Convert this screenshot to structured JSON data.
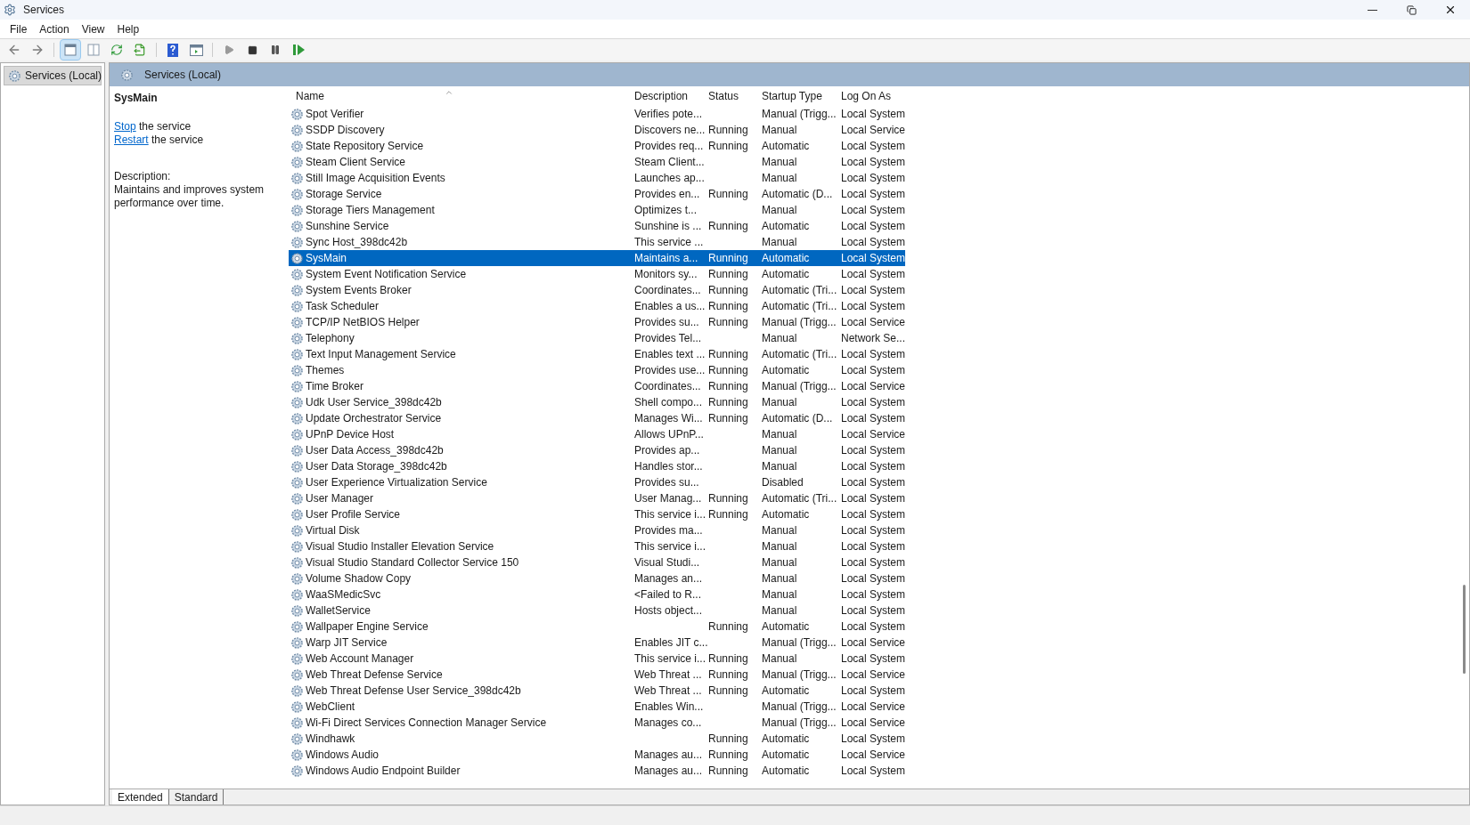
{
  "window": {
    "title": "Services"
  },
  "menu": [
    "File",
    "Action",
    "View",
    "Help"
  ],
  "tree": {
    "items": [
      {
        "label": "Services (Local)",
        "selected": true
      }
    ]
  },
  "pane": {
    "title": "Services (Local)"
  },
  "details": {
    "service_name": "SysMain",
    "actions": [
      {
        "link": "Stop",
        "text": "the service"
      },
      {
        "link": "Restart",
        "text": "the service"
      }
    ],
    "description_label": "Description:",
    "description": "Maintains and improves system performance over time."
  },
  "table": {
    "columns": [
      "Name",
      "Description",
      "Status",
      "Startup Type",
      "Log On As"
    ],
    "rows": [
      {
        "name": "Spot Verifier",
        "description": "Verifies pote...",
        "startup_type": "Manual (Trigg...",
        "log_on_as": "Local System",
        "selected": false
      },
      {
        "name": "SSDP Discovery",
        "description": "Discovers ne...",
        "status": "Running",
        "startup_type": "Manual",
        "log_on_as": "Local Service",
        "selected": false
      },
      {
        "name": "State Repository Service",
        "description": "Provides req...",
        "status": "Running",
        "startup_type": "Automatic",
        "log_on_as": "Local System",
        "selected": false
      },
      {
        "name": "Steam Client Service",
        "description": "Steam Client...",
        "startup_type": "Manual",
        "log_on_as": "Local System",
        "selected": false
      },
      {
        "name": "Still Image Acquisition Events",
        "description": "Launches ap...",
        "startup_type": "Manual",
        "log_on_as": "Local System",
        "selected": false
      },
      {
        "name": "Storage Service",
        "description": "Provides en...",
        "status": "Running",
        "startup_type": "Automatic (D...",
        "log_on_as": "Local System",
        "selected": false
      },
      {
        "name": "Storage Tiers Management",
        "description": "Optimizes t...",
        "startup_type": "Manual",
        "log_on_as": "Local System",
        "selected": false
      },
      {
        "name": "Sunshine Service",
        "description": "Sunshine is ...",
        "status": "Running",
        "startup_type": "Automatic",
        "log_on_as": "Local System",
        "selected": false
      },
      {
        "name": "Sync Host_398dc42b",
        "description": "This service ...",
        "startup_type": "Manual",
        "log_on_as": "Local System",
        "selected": false
      },
      {
        "name": "SysMain",
        "description": "Maintains a...",
        "status": "Running",
        "startup_type": "Automatic",
        "log_on_as": "Local System",
        "selected": true
      },
      {
        "name": "System Event Notification Service",
        "description": "Monitors sy...",
        "status": "Running",
        "startup_type": "Automatic",
        "log_on_as": "Local System",
        "selected": false
      },
      {
        "name": "System Events Broker",
        "description": "Coordinates...",
        "status": "Running",
        "startup_type": "Automatic (Tri...",
        "log_on_as": "Local System",
        "selected": false
      },
      {
        "name": "Task Scheduler",
        "description": "Enables a us...",
        "status": "Running",
        "startup_type": "Automatic (Tri...",
        "log_on_as": "Local System",
        "selected": false
      },
      {
        "name": "TCP/IP NetBIOS Helper",
        "description": "Provides su...",
        "status": "Running",
        "startup_type": "Manual (Trigg...",
        "log_on_as": "Local Service",
        "selected": false
      },
      {
        "name": "Telephony",
        "description": "Provides Tel...",
        "startup_type": "Manual",
        "log_on_as": "Network Se...",
        "selected": false
      },
      {
        "name": "Text Input Management Service",
        "description": "Enables text ...",
        "status": "Running",
        "startup_type": "Automatic (Tri...",
        "log_on_as": "Local System",
        "selected": false
      },
      {
        "name": "Themes",
        "description": "Provides use...",
        "status": "Running",
        "startup_type": "Automatic",
        "log_on_as": "Local System",
        "selected": false
      },
      {
        "name": "Time Broker",
        "description": "Coordinates...",
        "status": "Running",
        "startup_type": "Manual (Trigg...",
        "log_on_as": "Local Service",
        "selected": false
      },
      {
        "name": "Udk User Service_398dc42b",
        "description": "Shell compo...",
        "status": "Running",
        "startup_type": "Manual",
        "log_on_as": "Local System",
        "selected": false
      },
      {
        "name": "Update Orchestrator Service",
        "description": "Manages Wi...",
        "status": "Running",
        "startup_type": "Automatic (D...",
        "log_on_as": "Local System",
        "selected": false
      },
      {
        "name": "UPnP Device Host",
        "description": "Allows UPnP...",
        "startup_type": "Manual",
        "log_on_as": "Local Service",
        "selected": false
      },
      {
        "name": "User Data Access_398dc42b",
        "description": "Provides ap...",
        "startup_type": "Manual",
        "log_on_as": "Local System",
        "selected": false
      },
      {
        "name": "User Data Storage_398dc42b",
        "description": "Handles stor...",
        "startup_type": "Manual",
        "log_on_as": "Local System",
        "selected": false
      },
      {
        "name": "User Experience Virtualization Service",
        "description": "Provides su...",
        "startup_type": "Disabled",
        "log_on_as": "Local System",
        "selected": false
      },
      {
        "name": "User Manager",
        "description": "User Manag...",
        "status": "Running",
        "startup_type": "Automatic (Tri...",
        "log_on_as": "Local System",
        "selected": false
      },
      {
        "name": "User Profile Service",
        "description": "This service i...",
        "status": "Running",
        "startup_type": "Automatic",
        "log_on_as": "Local System",
        "selected": false
      },
      {
        "name": "Virtual Disk",
        "description": "Provides ma...",
        "startup_type": "Manual",
        "log_on_as": "Local System",
        "selected": false
      },
      {
        "name": "Visual Studio Installer Elevation Service",
        "description": "This service i...",
        "startup_type": "Manual",
        "log_on_as": "Local System",
        "selected": false
      },
      {
        "name": "Visual Studio Standard Collector Service 150",
        "description": "Visual Studi...",
        "startup_type": "Manual",
        "log_on_as": "Local System",
        "selected": false
      },
      {
        "name": "Volume Shadow Copy",
        "description": "Manages an...",
        "startup_type": "Manual",
        "log_on_as": "Local System",
        "selected": false
      },
      {
        "name": "WaaSMedicSvc",
        "description": "<Failed to R...",
        "startup_type": "Manual",
        "log_on_as": "Local System",
        "selected": false
      },
      {
        "name": "WalletService",
        "description": "Hosts object...",
        "startup_type": "Manual",
        "log_on_as": "Local System",
        "selected": false
      },
      {
        "name": "Wallpaper Engine Service",
        "status": "Running",
        "startup_type": "Automatic",
        "log_on_as": "Local System",
        "selected": false
      },
      {
        "name": "Warp JIT Service",
        "description": "Enables JIT c...",
        "startup_type": "Manual (Trigg...",
        "log_on_as": "Local Service",
        "selected": false
      },
      {
        "name": "Web Account Manager",
        "description": "This service i...",
        "status": "Running",
        "startup_type": "Manual",
        "log_on_as": "Local System",
        "selected": false
      },
      {
        "name": "Web Threat Defense Service",
        "description": "Web Threat ...",
        "status": "Running",
        "startup_type": "Manual (Trigg...",
        "log_on_as": "Local Service",
        "selected": false
      },
      {
        "name": "Web Threat Defense User Service_398dc42b",
        "description": "Web Threat ...",
        "status": "Running",
        "startup_type": "Automatic",
        "log_on_as": "Local System",
        "selected": false
      },
      {
        "name": "WebClient",
        "description": "Enables Win...",
        "startup_type": "Manual (Trigg...",
        "log_on_as": "Local Service",
        "selected": false
      },
      {
        "name": "Wi-Fi Direct Services Connection Manager Service",
        "description": "Manages co...",
        "startup_type": "Manual (Trigg...",
        "log_on_as": "Local Service",
        "selected": false
      },
      {
        "name": "Windhawk",
        "status": "Running",
        "startup_type": "Automatic",
        "log_on_as": "Local System",
        "selected": false
      },
      {
        "name": "Windows Audio",
        "description": "Manages au...",
        "status": "Running",
        "startup_type": "Automatic",
        "log_on_as": "Local Service",
        "selected": false
      },
      {
        "name": "Windows Audio Endpoint Builder",
        "description": "Manages au...",
        "status": "Running",
        "startup_type": "Automatic",
        "log_on_as": "Local System",
        "selected": false
      }
    ]
  },
  "view_tabs": [
    {
      "label": "Extended",
      "selected": true
    },
    {
      "label": "Standard",
      "selected": false
    }
  ]
}
